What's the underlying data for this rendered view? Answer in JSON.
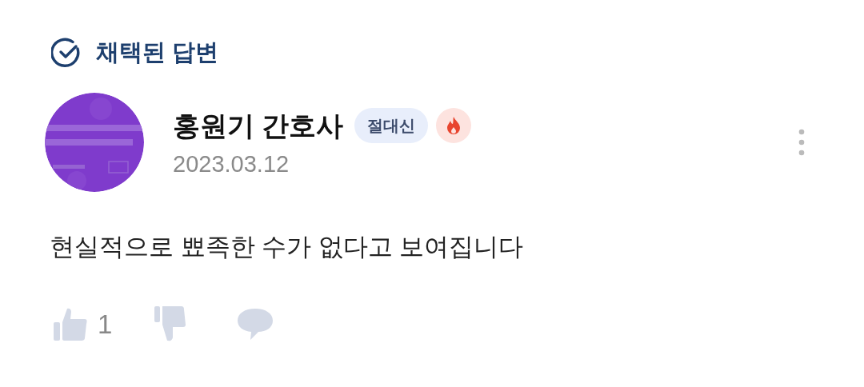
{
  "header": {
    "title": "채택된 답변"
  },
  "author": {
    "name": "홍원기 간호사",
    "badge": "절대신",
    "date": "2023.03.12"
  },
  "answer": {
    "text": "현실적으로 뾰족한 수가 없다고 보여집니다"
  },
  "actions": {
    "likes": "1"
  }
}
